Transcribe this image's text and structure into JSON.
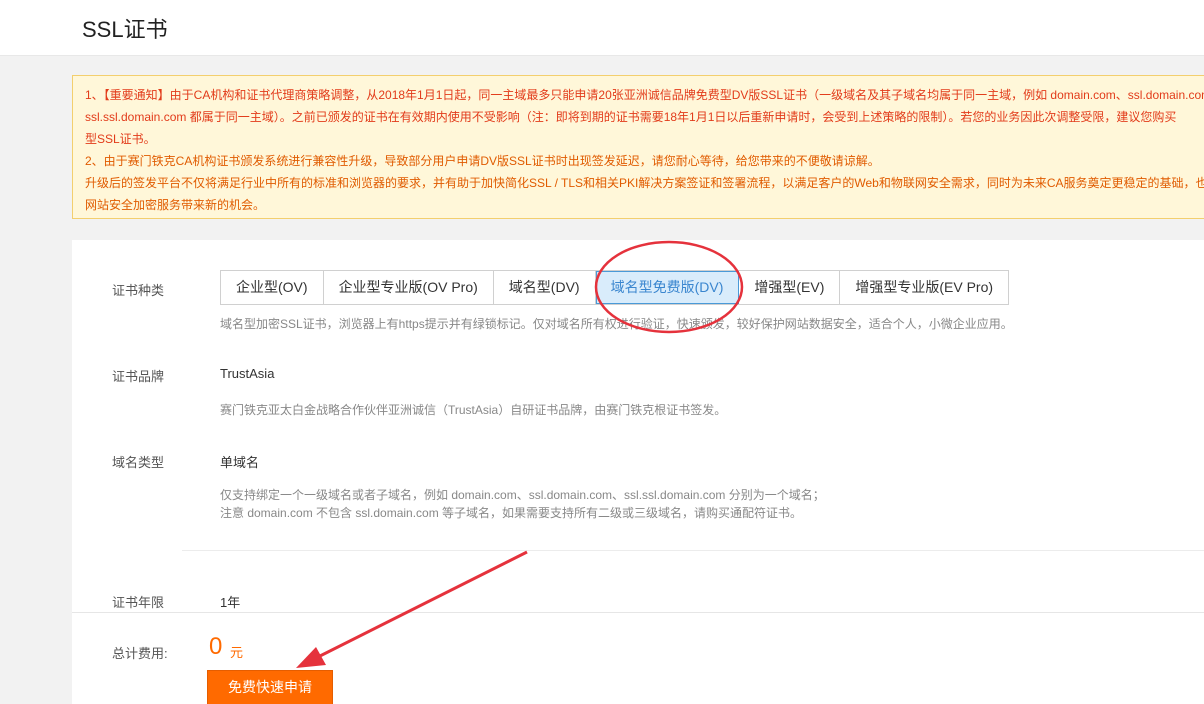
{
  "header": {
    "title": "SSL证书"
  },
  "notice": {
    "lines": [
      "1、【重要通知】由于CA机构和证书代理商策略调整，从2018年1月1日起，同一主域最多只能申请20张亚洲诚信品牌免费型DV版SSL证书（一级域名及其子域名均属于同一主域，例如 domain.com、ssl.domain.com、",
      "ssl.ssl.domain.com 都属于同一主域）。之前已颁发的证书在有效期内使用不受影响（注：即将到期的证书需要18年1月1日以后重新申请时，会受到上述策略的限制）。若您的业务因此次调整受限，建议您购买",
      "型SSL证书。",
      "2、由于赛门铁克CA机构证书颁发系统进行兼容性升级，导致部分用户申请DV版SSL证书时出现签发延迟，请您耐心等待，给您带来的不便敬请谅解。",
      "升级后的签发平台不仅将满足行业中所有的标准和浏览器的要求，并有助于加快简化SSL / TLS和相关PKI解决方案签证和签署流程，以满足客户的Web和物联网安全需求，同时为未来CA服务奠定更稳定的基础，也",
      "网站安全加密服务带来新的机会。"
    ]
  },
  "cert_type": {
    "label": "证书种类",
    "tabs": [
      "企业型(OV)",
      "企业型专业版(OV Pro)",
      "域名型(DV)",
      "域名型免费版(DV)",
      "增强型(EV)",
      "增强型专业版(EV Pro)"
    ],
    "active_index": 3,
    "desc": "域名型加密SSL证书，浏览器上有https提示并有绿锁标记。仅对域名所有权进行验证，快速颁发，较好保护网站数据安全，适合个人，小微企业应用。"
  },
  "brand": {
    "label": "证书品牌",
    "value": "TrustAsia",
    "desc": "赛门铁克亚太白金战略合作伙伴亚洲诚信（TrustAsia）自研证书品牌，由赛门铁克根证书签发。"
  },
  "domain_type": {
    "label": "域名类型",
    "value": "单域名",
    "desc_line1": "仅支持绑定一个一级域名或者子域名，例如 domain.com、ssl.domain.com、ssl.ssl.domain.com 分别为一个域名；",
    "desc_line2": "注意 domain.com 不包含 ssl.domain.com 等子域名，如果需要支持所有二级或三级域名，请购买通配符证书。"
  },
  "term": {
    "label": "证书年限",
    "value": "1年"
  },
  "footer": {
    "total_label": "总计费用:",
    "price": "0",
    "unit": "元",
    "buy_label": "免费快速申请"
  },
  "colors": {
    "accent": "#ff6a00",
    "annotation": "#e5323c",
    "active_tab": "#d9ecfb"
  }
}
